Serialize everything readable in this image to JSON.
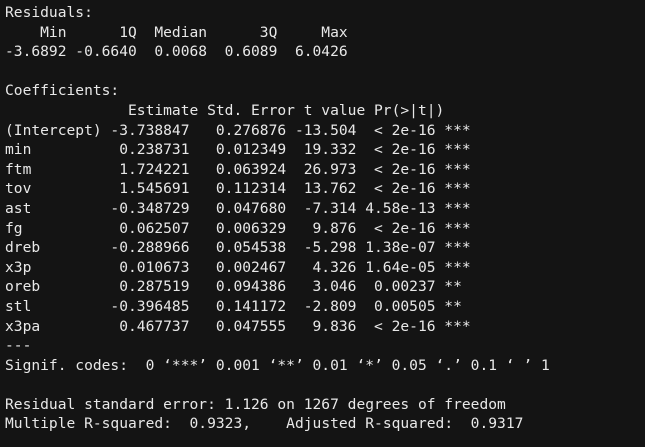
{
  "residuals": {
    "title": "Residuals:",
    "header": "    Min      1Q  Median      3Q     Max ",
    "values": "-3.6892 -0.6640  0.0068  0.6089  6.0426 "
  },
  "coefficients": {
    "title": "Coefficients:",
    "header": "              Estimate Std. Error t value Pr(>|t|)    ",
    "rows": [
      "(Intercept) -3.738847   0.276876 -13.504  < 2e-16 ***",
      "min          0.238731   0.012349  19.332  < 2e-16 ***",
      "ftm          1.724221   0.063924  26.973  < 2e-16 ***",
      "tov          1.545691   0.112314  13.762  < 2e-16 ***",
      "ast         -0.348729   0.047680  -7.314 4.58e-13 ***",
      "fg           0.062507   0.006329   9.876  < 2e-16 ***",
      "dreb        -0.288966   0.054538  -5.298 1.38e-07 ***",
      "x3p          0.010673   0.002467   4.326 1.64e-05 ***",
      "oreb         0.287519   0.094386   3.046  0.00237 ** ",
      "stl         -0.396485   0.141172  -2.809  0.00505 ** ",
      "x3pa         0.467737   0.047555   9.836  < 2e-16 ***"
    ],
    "separator": "---",
    "signif_codes": "Signif. codes:  0 ‘***’ 0.001 ‘**’ 0.01 ‘*’ 0.05 ‘.’ 0.1 ‘ ’ 1"
  },
  "summary": {
    "residual_se": "Residual standard error: 1.126 on 1267 degrees of freedom",
    "r_squared": "Multiple R-squared:  0.9323,\tAdjusted R-squared:  0.9317 "
  }
}
